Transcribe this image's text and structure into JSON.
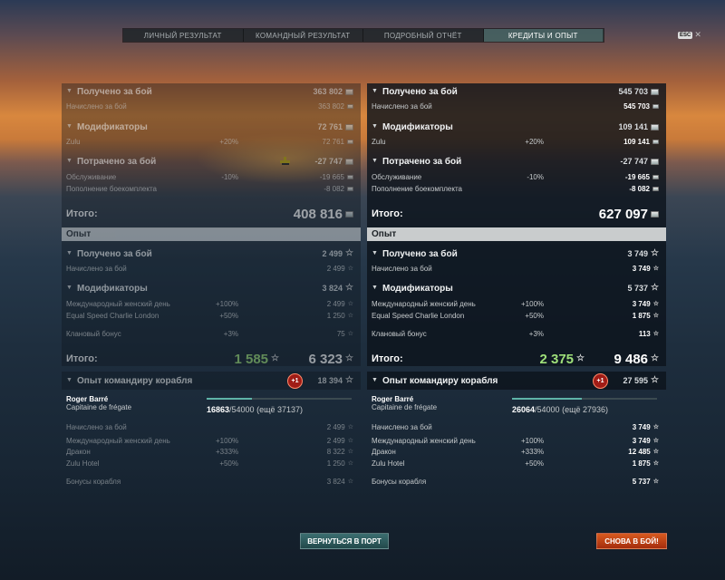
{
  "tabs": [
    "ЛИЧНЫЙ РЕЗУЛЬТАТ",
    "КОМАНДНЫЙ РЕЗУЛЬТАТ",
    "ПОДРОБНЫЙ ОТЧЁТ",
    "КРЕДИТЫ И ОПЫТ"
  ],
  "active_tab": 3,
  "esc": {
    "key": "ESC",
    "close": "✕"
  },
  "left": {
    "earned_label": "Получено за бой",
    "earned_value": "363 802",
    "accrued_label": "Начислено за бой",
    "accrued_value": "363 802",
    "modifiers_label": "Модификаторы",
    "modifiers_value": "72 761",
    "zulu_label": "Zulu",
    "zulu_pct": "+20%",
    "zulu_value": "72 761",
    "spent_label": "Потрачено за бой",
    "spent_value": "-27 747",
    "service_label": "Обслуживание",
    "service_pct": "-10%",
    "service_value": "-19 665",
    "ammo_label": "Пополнение боекомплекта",
    "ammo_value": "-8 082",
    "total_label": "Итого:",
    "total_credits": "408 816",
    "xp_header": "Опыт",
    "xp_earned_label": "Получено за бой",
    "xp_earned_value": "2 499",
    "xp_accrued_label": "Начислено за бой",
    "xp_accrued_value": "2 499",
    "xp_mod_label": "Модификаторы",
    "xp_mod_value": "3 824",
    "womens_day_label": "Международный женский день",
    "womens_day_pct": "+100%",
    "womens_day_value": "2 499",
    "equal_speed_label": "Equal Speed Charlie London",
    "equal_speed_pct": "+50%",
    "equal_speed_value": "1 250",
    "clan_label": "Клановый бонус",
    "clan_pct": "+3%",
    "clan_value": "75",
    "xp_total_label": "Итого:",
    "xp_total_ship": "1 585",
    "xp_total_free": "6 323",
    "cmdr_header": "Опыт командиру корабля",
    "cmdr_badge": "+1",
    "cmdr_value": "18 394",
    "cmdr_name": "Roger Barré",
    "cmdr_rank": "Capitaine de frégate",
    "cmdr_xp_current": "16863",
    "cmdr_xp_sep": "/54000",
    "cmdr_xp_remaining": "(ещё 37137)",
    "cmdr_xp_fraction": 0.312,
    "c_accrued_label": "Начислено за бой",
    "c_accrued_value": "2 499",
    "c_womens_label": "Международный женский день",
    "c_womens_pct": "+100%",
    "c_womens_value": "2 499",
    "c_dragon_label": "Дракон",
    "c_dragon_pct": "+333%",
    "c_dragon_value": "8 322",
    "c_zulu_label": "Zulu Hotel",
    "c_zulu_pct": "+50%",
    "c_zulu_value": "1 250",
    "c_ship_bonus_label": "Бонусы корабля",
    "c_ship_bonus_value": "3 824"
  },
  "right": {
    "earned_label": "Получено за бой",
    "earned_value": "545 703",
    "accrued_label": "Начислено за бой",
    "accrued_value": "545 703",
    "modifiers_label": "Модификаторы",
    "modifiers_value": "109 141",
    "zulu_label": "Zulu",
    "zulu_pct": "+20%",
    "zulu_value": "109 141",
    "spent_label": "Потрачено за бой",
    "spent_value": "-27 747",
    "service_label": "Обслуживание",
    "service_pct": "-10%",
    "service_value": "-19 665",
    "ammo_label": "Пополнение боекомплекта",
    "ammo_value": "-8 082",
    "total_label": "Итого:",
    "total_credits": "627 097",
    "xp_header": "Опыт",
    "xp_earned_label": "Получено за бой",
    "xp_earned_value": "3 749",
    "xp_accrued_label": "Начислено за бой",
    "xp_accrued_value": "3 749",
    "xp_mod_label": "Модификаторы",
    "xp_mod_value": "5 737",
    "womens_day_label": "Международный женский день",
    "womens_day_pct": "+100%",
    "womens_day_value": "3 749",
    "equal_speed_label": "Equal Speed Charlie London",
    "equal_speed_pct": "+50%",
    "equal_speed_value": "1 875",
    "clan_label": "Клановый бонус",
    "clan_pct": "+3%",
    "clan_value": "113",
    "xp_total_label": "Итого:",
    "xp_total_ship": "2 375",
    "xp_total_free": "9 486",
    "cmdr_header": "Опыт командиру корабля",
    "cmdr_badge": "+1",
    "cmdr_value": "27 595",
    "cmdr_name": "Roger Barré",
    "cmdr_rank": "Capitaine de frégate",
    "cmdr_xp_current": "26064",
    "cmdr_xp_sep": "/54000",
    "cmdr_xp_remaining": "(ещё 27936)",
    "cmdr_xp_fraction": 0.483,
    "c_accrued_label": "Начислено за бой",
    "c_accrued_value": "3 749",
    "c_womens_label": "Международный женский день",
    "c_womens_pct": "+100%",
    "c_womens_value": "3 749",
    "c_dragon_label": "Дракон",
    "c_dragon_pct": "+333%",
    "c_dragon_value": "12 485",
    "c_zulu_label": "Zulu Hotel",
    "c_zulu_pct": "+50%",
    "c_zulu_value": "1 875",
    "c_ship_bonus_label": "Бонусы корабля",
    "c_ship_bonus_value": "5 737"
  },
  "buttons": {
    "port": "ВЕРНУТЬСЯ В ПОРТ",
    "battle": "СНОВА В БОЙ!"
  }
}
